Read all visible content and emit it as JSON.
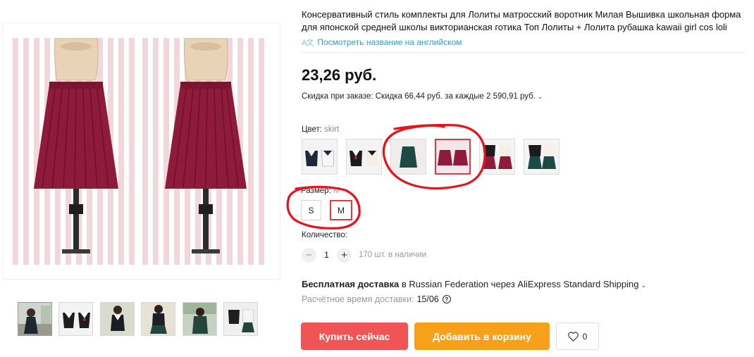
{
  "product": {
    "title": "Консервативный стиль комплекты для Лолиты матросский воротник Милая Вышивка школьная форма для японской средней школы викторианская готика Топ Лолиты + Лолита рубашка kawaii girl cos loli",
    "translate_link": "Посмотреть название на английском",
    "price": "23,26 руб.",
    "discount": "Скидка при заказе: Скидка 66,44 руб. за каждые 2 590,91 руб."
  },
  "options": {
    "color_label": "Цвет:",
    "color_value": "skirt",
    "size_label": "Размер:",
    "size_value": "M",
    "sizes": [
      "S",
      "M"
    ],
    "selected_swatch_index": 3,
    "swatch_icons": [
      "sailor-top-white-navy-icon",
      "sailor-top-black-icon",
      "green-skirt-icon",
      "wine-skirt-icon",
      "set-wine-icon",
      "set-green-icon"
    ]
  },
  "quantity": {
    "label": "Количество:",
    "value": "1",
    "minus": "−",
    "plus": "+",
    "stock": "170 шт. в наличии"
  },
  "shipping": {
    "free": "Бесплатная доставка",
    "detail": "в Russian Federation через AliExpress Standard Shipping",
    "eta_label": "Расчётное время доставки:",
    "eta_value": "15/06"
  },
  "actions": {
    "buy": "Купить сейчас",
    "cart": "Добавить в корзину",
    "wish_count": "0"
  },
  "gallery": {
    "thumb_icons": [
      "photo-girl-uniform-icon",
      "photo-sailor-tops-icon",
      "photo-girl-pose-icon",
      "photo-girl-standing-icon",
      "photo-girl-outdoor-icon",
      "photo-uniform-set-icon"
    ]
  },
  "colors": {
    "accent_red": "#e4393c",
    "buy_red": "#f05454",
    "cart_orange": "#f9a01b",
    "link_blue": "#2a9fd6",
    "skirt_wine": "#8e1a3c"
  }
}
